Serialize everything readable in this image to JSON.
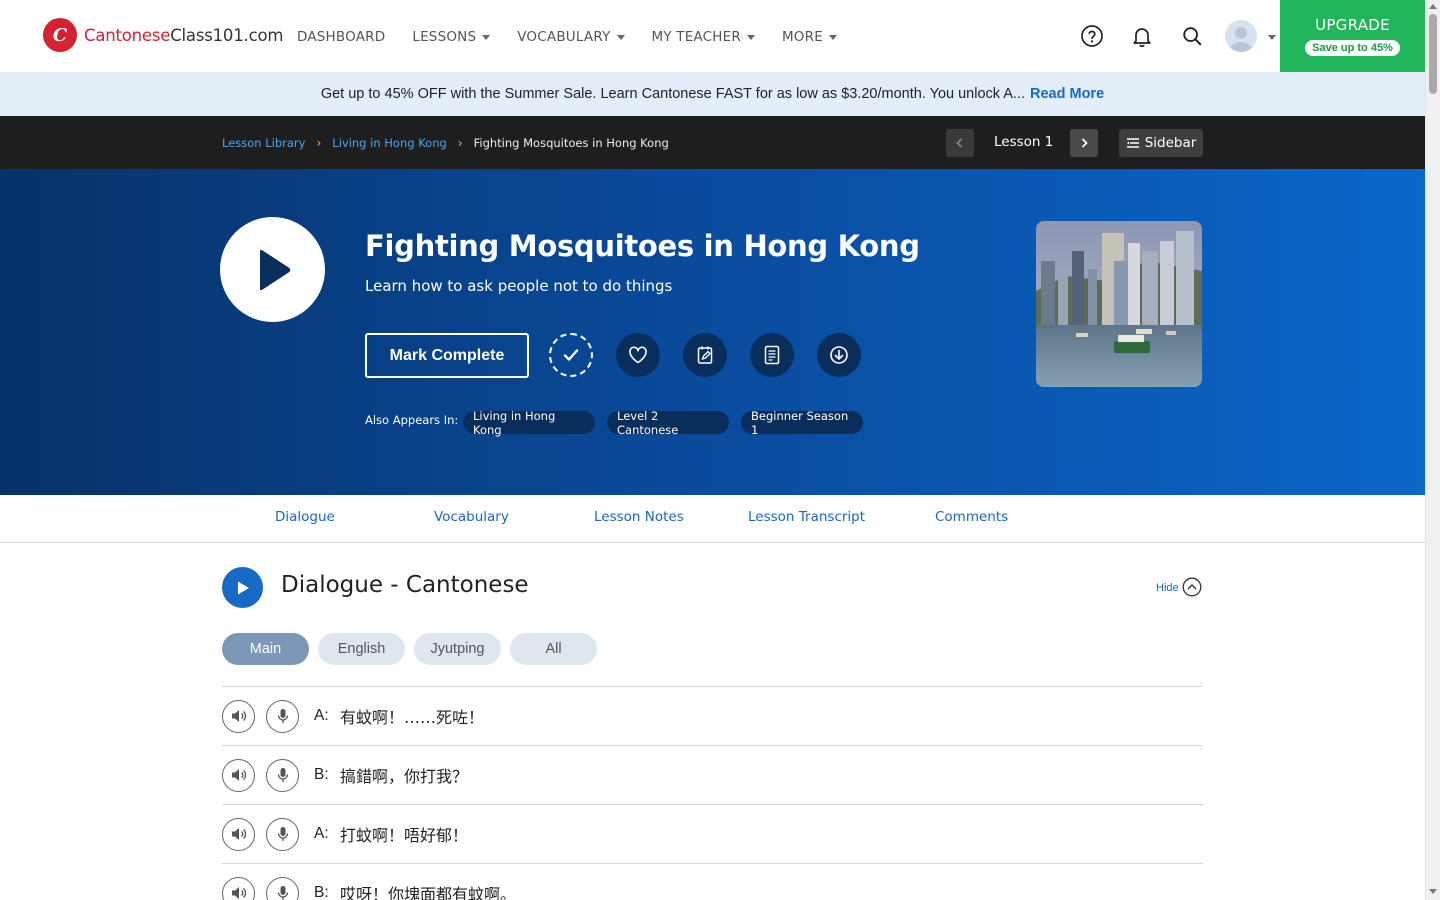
{
  "brand": {
    "part1": "Cantonese",
    "part2": "Class101.com",
    "mark": "C",
    "color": "#d32230"
  },
  "nav": {
    "items": [
      {
        "label": "DASHBOARD",
        "caret": false
      },
      {
        "label": "LESSONS",
        "caret": true
      },
      {
        "label": "VOCABULARY",
        "caret": true
      },
      {
        "label": "MY TEACHER",
        "caret": true
      },
      {
        "label": "MORE",
        "caret": true
      }
    ],
    "icons": [
      "help-icon",
      "bell-icon",
      "search-icon",
      "avatar"
    ]
  },
  "upgrade": {
    "title": "UPGRADE",
    "subtitle": "Save up to 45%",
    "color": "#21b65a"
  },
  "promo": {
    "text": "Get up to 45% OFF with the Summer Sale. Learn Cantonese FAST for as low as $3.20/month. You unlock A...",
    "link": "Read More"
  },
  "breadcrumb": {
    "items": [
      "Lesson Library",
      "Living in Hong Kong"
    ],
    "current": "Fighting Mosquitoes in Hong Kong"
  },
  "lesson_nav": {
    "label": "Lesson 1",
    "sidebar_label": "Sidebar"
  },
  "hero": {
    "title": "Fighting Mosquitoes in Hong Kong",
    "subtitle": "Learn how to ask people not to do things",
    "mark_complete": "Mark Complete",
    "action_icons": [
      "check-icon",
      "heart-icon",
      "notes-icon",
      "pdf-icon",
      "download-icon"
    ],
    "also_label": "Also Appears In:",
    "tags": [
      "Living in Hong Kong",
      "Level 2 Cantonese",
      "Beginner Season 1"
    ]
  },
  "tabs": [
    "Dialogue",
    "Vocabulary",
    "Lesson Notes",
    "Lesson Transcript",
    "Comments"
  ],
  "dialogue": {
    "title": "Dialogue - Cantonese",
    "hide_label": "Hide",
    "filters": [
      "Main",
      "English",
      "Jyutping",
      "All"
    ],
    "active_filter": "Main",
    "lines": [
      {
        "speaker": "A:",
        "text": "有蚊啊！……死咗！"
      },
      {
        "speaker": "B:",
        "text": "搞錯啊，你打我？"
      },
      {
        "speaker": "A:",
        "text": "打蚊啊！唔好郁！"
      },
      {
        "speaker": "B:",
        "text": "哎呀！你塊面都有蚊啊。"
      }
    ]
  },
  "colors": {
    "link": "#1669c5",
    "hero_dark": "#073269",
    "hero_light": "#0b67c9"
  }
}
